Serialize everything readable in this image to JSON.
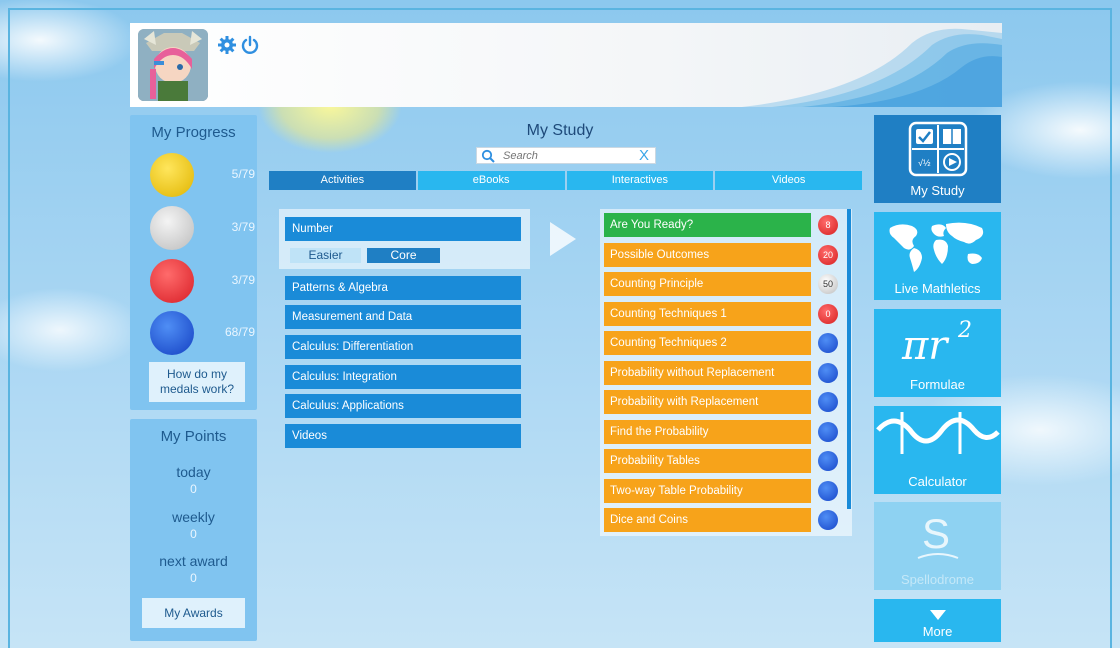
{
  "header": {
    "title": "",
    "subtitle": ""
  },
  "progress": {
    "title": "My Progress",
    "medals": [
      {
        "name": "gold",
        "count": "5/79",
        "color": "#f2c500"
      },
      {
        "name": "silver",
        "count": "3/79",
        "color": "#cfcfcf"
      },
      {
        "name": "red",
        "count": "3/79",
        "color": "#e8343a"
      },
      {
        "name": "blue",
        "count": "68/79",
        "color": "#1b55d6"
      }
    ],
    "help_button": "How do my medals work?"
  },
  "points": {
    "title": "My Points",
    "rows": [
      {
        "label": "today",
        "value": "0"
      },
      {
        "label": "weekly",
        "value": "0"
      },
      {
        "label": "next award",
        "value": "0"
      }
    ],
    "awards_button": "My Awards"
  },
  "study": {
    "title": "My Study",
    "search": {
      "placeholder": "Search",
      "value": ""
    },
    "tabs": [
      "Activities",
      "eBooks",
      "Interactives",
      "Videos"
    ],
    "active_tab": "Activities",
    "topics": [
      "Number",
      "Patterns & Algebra",
      "Measurement and Data",
      "Calculus: Differentiation",
      "Calculus: Integration",
      "Calculus: Applications",
      "Videos"
    ],
    "levels": [
      "Easier",
      "Core"
    ],
    "selected_level": "Core",
    "activities": [
      {
        "label": "Are You Ready?",
        "color": "green",
        "badge": "8",
        "badge_type": "red"
      },
      {
        "label": "Possible Outcomes",
        "color": "orange",
        "badge": "20",
        "badge_type": "red"
      },
      {
        "label": "Counting Principle",
        "color": "orange",
        "badge": "50",
        "badge_type": "silver"
      },
      {
        "label": "Counting Techniques 1",
        "color": "orange",
        "badge": "0",
        "badge_type": "red"
      },
      {
        "label": "Counting Techniques 2",
        "color": "orange",
        "badge": "",
        "badge_type": "blue"
      },
      {
        "label": "Probability without Replacement",
        "color": "orange",
        "badge": "",
        "badge_type": "blue"
      },
      {
        "label": "Probability with Replacement",
        "color": "orange",
        "badge": "",
        "badge_type": "blue"
      },
      {
        "label": "Find the Probability",
        "color": "orange",
        "badge": "",
        "badge_type": "blue"
      },
      {
        "label": "Probability Tables",
        "color": "orange",
        "badge": "",
        "badge_type": "blue"
      },
      {
        "label": "Two-way Table Probability",
        "color": "orange",
        "badge": "",
        "badge_type": "blue"
      },
      {
        "label": "Dice and Coins",
        "color": "orange",
        "badge": "",
        "badge_type": "blue"
      }
    ]
  },
  "tiles": {
    "my_study": "My Study",
    "live_mathletics": "Live Mathletics",
    "formulae": "Formulae",
    "calculator": "Calculator",
    "spellodrome": "Spellodrome",
    "more": "More"
  },
  "icons": {
    "settings": "gear-icon",
    "logout": "power-icon",
    "search": "search-icon",
    "clear": "close-icon",
    "play": "play-arrow-icon",
    "more": "chevron-down-icon"
  },
  "colors": {
    "accent": "#1a8bd8",
    "tab": "#29b7ef",
    "tab_active": "#1f7fc4",
    "activity_green": "#2bb34a",
    "activity_orange": "#f7a31a",
    "panel": "#80c4f0",
    "tile_dark": "#1f7fc4",
    "tile": "#29b7ef"
  }
}
